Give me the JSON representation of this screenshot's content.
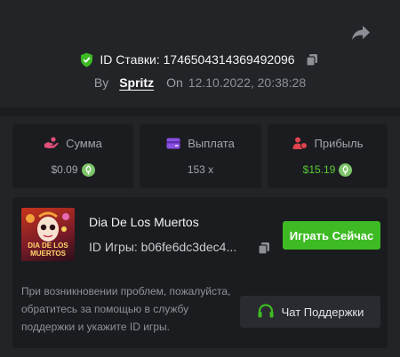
{
  "bet": {
    "id_label": "ID Ставки: 1746504314369492096",
    "by_label": "By",
    "user": "Spritz",
    "on_label": "On",
    "date": "12.10.2022, 20:38:28"
  },
  "stats": [
    {
      "label": "Сумма",
      "value": "$0.09",
      "icon": "hand-coins-icon",
      "icon_color": "#e0517a",
      "value_color": "#a3a5ab",
      "coin": true
    },
    {
      "label": "Выплата",
      "value": "153 x",
      "icon": "wallet-icon",
      "icon_color": "#8a4fe3",
      "value_color": "#a3a5ab",
      "coin": false
    },
    {
      "label": "Прибыль",
      "value": "$15.19",
      "icon": "profit-icon",
      "icon_color": "#e0434e",
      "value_color": "#5ac935",
      "coin": true
    }
  ],
  "game": {
    "name": "Dia De Los Muertos",
    "thumb_title": "DIA DE LOS MUERTOS",
    "id_label": "ID Игры: b06fe6dc3dec4...",
    "play_label": "Играть Сейчас"
  },
  "support": {
    "help_text": "При возникновении проблем, пожалуйста, обратитесь за помощью в службу поддержки и укажите ID игры.",
    "button_label": "Чат Поддержки"
  },
  "colors": {
    "accent_green": "#3ebb24",
    "background": "#232428",
    "card": "#1b1c20"
  }
}
